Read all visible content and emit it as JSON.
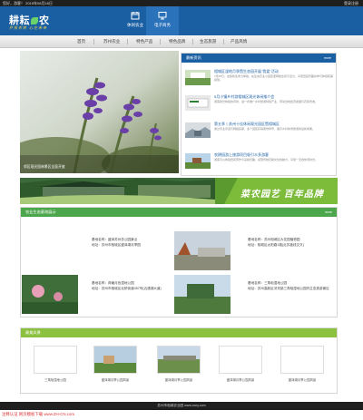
{
  "topbar": {
    "left": "您好，游客！ 2015年06月18日",
    "right": "登录注册"
  },
  "header": {
    "logo": "耕耘",
    "logo_tail": "农",
    "slogan": "开拓农耕 心在未来",
    "nav": [
      {
        "label": "休闲农业",
        "icon": "calendar-icon"
      },
      {
        "label": "电子商务",
        "icon": "monitor-icon"
      }
    ]
  },
  "menu": [
    "首页",
    "苏州农业",
    "特色产品",
    "特色品牌",
    "生态旅游",
    "产品风情"
  ],
  "hero": {
    "caption": "郊区观光园林景区全面开放"
  },
  "news": {
    "title": "最新资讯",
    "more": "more",
    "items": [
      {
        "title": "相城区湿地月季暨生态园开展\"我爱\"活动",
        "desc": "7月25日，这些新生命力体验，在生态农业小园区里释放生机与活力，享受田园乐趣并参与体验和美感受。"
      },
      {
        "title": "5月小镇乡村游相城区观光休闲推介会",
        "desc": "游客观光体验的同时，进一步推广乡村旅游特色产业，带动当地经济发展与农民增收。"
      },
      {
        "title": "第五季丨苏州十佳休闲观光园区暨相城区",
        "desc": "通过专业评选与网络投票，多个园区获得荣誉称号，展示乡村休闲旅游的最新成果。"
      },
      {
        "title": "农耕园游上旅游项目吸引众多游客",
        "desc": "游客可以体验田间劳作与采摘乐趣，感受传统农耕文化的魅力，享受一天的休闲时光。"
      }
    ]
  },
  "banner": {
    "text": "菜农园艺 百年品牌"
  },
  "bases": {
    "title": "农业生态基地展示",
    "more": "more",
    "items": [
      {
        "name": "基地名称：盛泽苏州苏公园景点",
        "addr": "地址：苏州市相城区盛泽湖月季园"
      },
      {
        "name": "基地名称：苏州相城区大花园植物园",
        "addr": "地址：相城区太阳路1路(近苏蠡线交叉)"
      },
      {
        "name": "基地名称：荷塘月色湿地公园",
        "addr": "地址：苏州市相城区北桥街道457号(近漕湖大道)"
      },
      {
        "name": "基地名称：三角咀湿地公园",
        "addr": "地址：苏州高新区浒关镇三角咀湿地公园内生态旅游景区"
      }
    ]
  },
  "scenic": {
    "title": "最美风景",
    "items": [
      "三角咀湿地公园",
      "盛泽湖月季公园风景",
      "盛泽湖月季公园风景",
      "盛泽湖月季公园风景",
      "盛泽湖月季公园风景"
    ]
  },
  "footer": {
    "text": "苏州市相城农业园 www.xxny.com"
  },
  "watermark": {
    "text": "注释认证 网页模板下载 www.ZH-CN.com"
  }
}
